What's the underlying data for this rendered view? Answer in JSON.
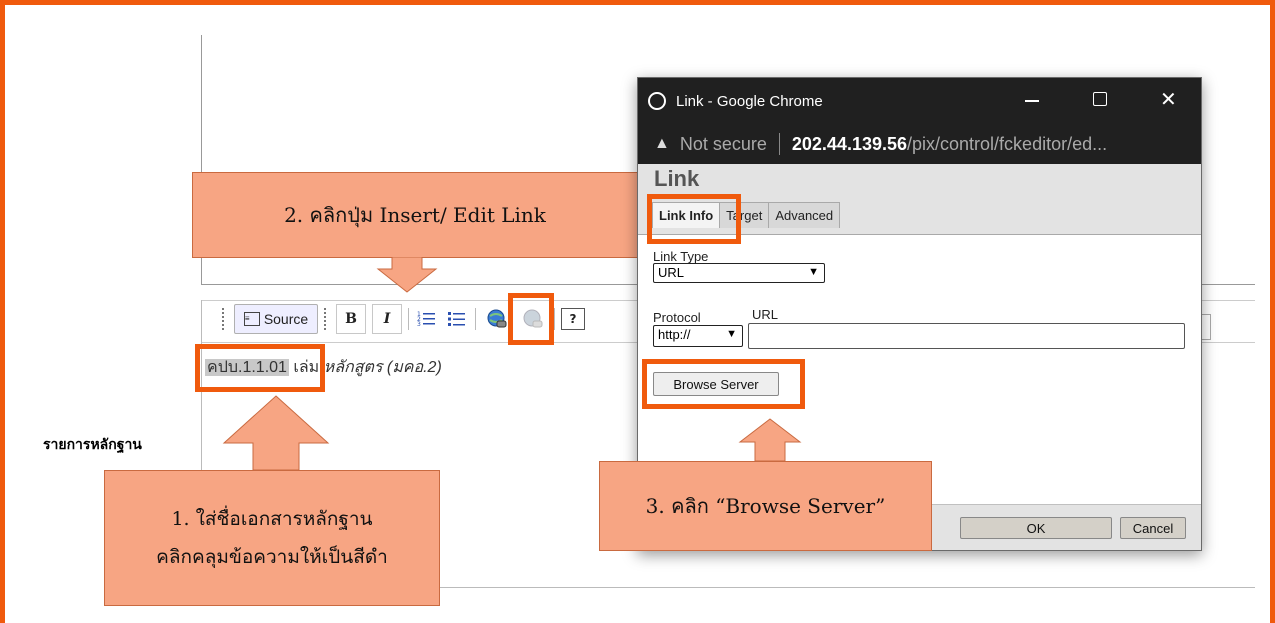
{
  "editor": {
    "toolbar": {
      "source_label": "Source",
      "bold_label": "B",
      "italic_label": "I",
      "help_label": "?"
    },
    "content": {
      "selected_text": "คปบ.1.1.01",
      "rest_text": " เล่ม",
      "italic_text": "หลักสูตร (มคอ.2)"
    }
  },
  "form_label": "รายการหลักฐาน",
  "popup": {
    "window_title": "Link - Google Chrome",
    "security_label": "Not secure",
    "url_host": "202.44.139.56",
    "url_path": "/pix/control/fckeditor/ed...",
    "dialog_title": "Link",
    "tabs": [
      "Link Info",
      "Target",
      "Advanced"
    ],
    "link_type_label": "Link Type",
    "link_type_value": "URL",
    "protocol_label": "Protocol",
    "protocol_value": "http://",
    "url_label": "URL",
    "url_value": "",
    "browse_label": "Browse Server",
    "ok_label": "OK",
    "cancel_label": "Cancel"
  },
  "callouts": {
    "step1_line1": "1. ใส่ชื่อเอกสารหลักฐาน",
    "step1_line2": "คลิกคลุมข้อความให้เป็นสีดำ",
    "step2": "2. คลิกปุ่ม Insert/ Edit Link",
    "step3": "3. คลิก “Browse Server”"
  },
  "colors": {
    "highlight": "#f05a0d",
    "callout_fill": "#f7a583",
    "titlebar": "#202020"
  }
}
